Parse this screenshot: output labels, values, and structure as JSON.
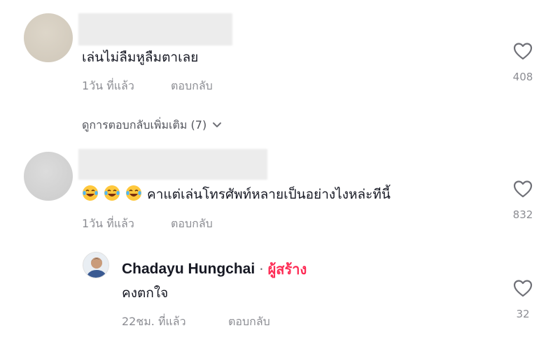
{
  "comments": [
    {
      "text": "เล่นไม่ลืมหูลืมตาเลย",
      "time": "1วัน ที่แล้ว",
      "reply_label": "ตอบกลับ",
      "likes": "408"
    },
    {
      "emoji": [
        "😂",
        "😂",
        "😂"
      ],
      "text": "คาแต่เล่นโทรศัพท์หลายเป็นอย่างไงหล่ะทีนี้",
      "time": "1วัน ที่แล้ว",
      "reply_label": "ตอบกลับ",
      "likes": "832"
    }
  ],
  "view_more": {
    "label": "ดูการตอบกลับเพิ่มเติม (7)",
    "icon": "chevron-down-icon"
  },
  "creator_reply": {
    "name": "Chadayu Hungchai",
    "separator": "·",
    "tag": "ผู้สร้าง",
    "text": "คงตกใจ",
    "time": "22ชม. ที่แล้ว",
    "reply_label": "ตอบกลับ",
    "likes": "32"
  },
  "colors": {
    "creator_tag": "#fe2c55",
    "secondary_text": "#8a8b91",
    "primary_text": "#161823"
  },
  "icons": {
    "like": "heart-outline-icon",
    "emoji": "face-with-tears-of-joy-icon"
  }
}
